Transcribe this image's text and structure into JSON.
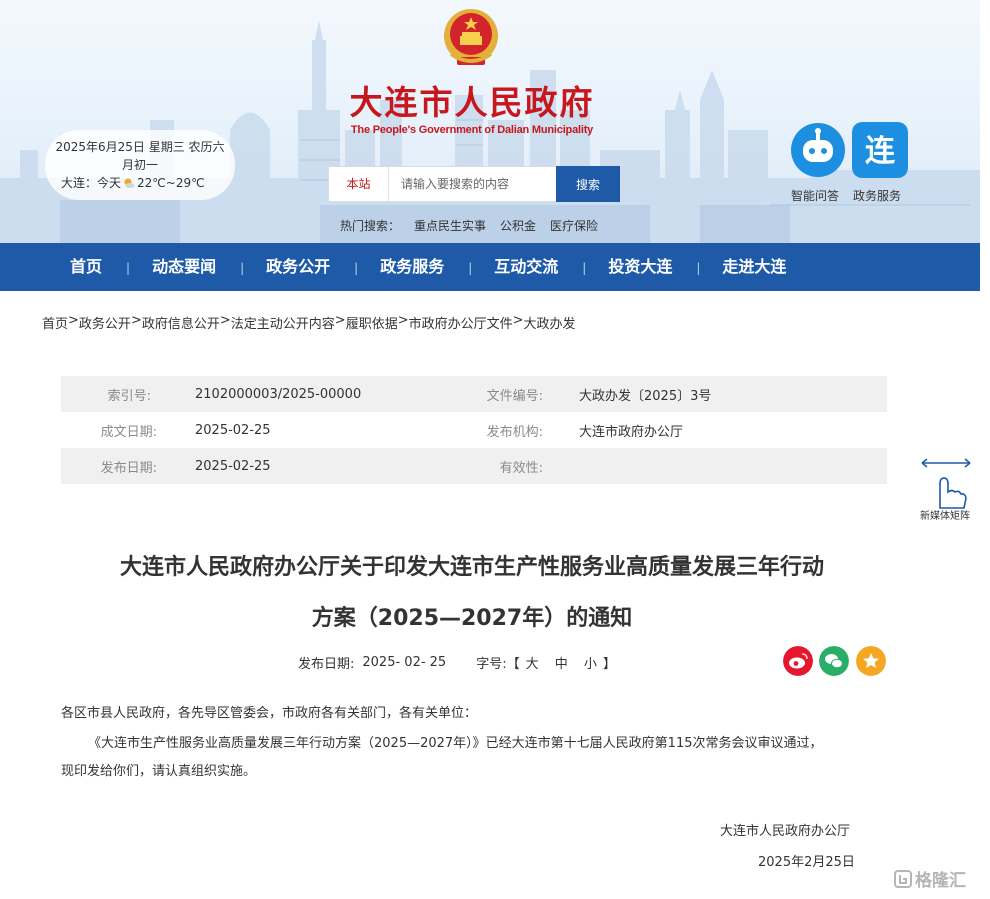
{
  "header": {
    "title": "大连市人民政府",
    "subtitle": "The People's Government of Dalian Municipality",
    "date_line1": "2025年6月25日 星期三 农历六",
    "date_line2": "月初一",
    "weather_prefix": "大连：今天",
    "weather_temp": "22℃~29℃",
    "search": {
      "scope": "本站",
      "placeholder": "请输入要搜索的内容",
      "button": "搜索"
    },
    "hot_search": {
      "label": "热门搜索：",
      "items": [
        "重点民生实事",
        "公积金",
        "医疗保险"
      ]
    },
    "quick_links": {
      "qa": "智能问答",
      "service": "政务服务",
      "service_glyph": "连"
    }
  },
  "nav": [
    "首页",
    "动态要闻",
    "政务公开",
    "政务服务",
    "互动交流",
    "投资大连",
    "走进大连"
  ],
  "breadcrumb": [
    "首页",
    "政务公开",
    "政府信息公开",
    "法定主动公开内容",
    "履职依据",
    "市政府办公厅文件",
    "大政办发"
  ],
  "meta": {
    "index_label": "索引号:",
    "index_value": "2102000003/2025-00000",
    "doc_no_label": "文件编号:",
    "doc_no_value": "大政办发〔2025〕3号",
    "written_label": "成文日期:",
    "written_value": "2025-02-25",
    "issuer_label": "发布机构:",
    "issuer_value": "大连市政府办公厅",
    "publish_label": "发布日期:",
    "publish_value": "2025-02-25",
    "validity_label": "有效性:",
    "validity_value": ""
  },
  "side": {
    "media_label": "新媒体矩阵"
  },
  "article": {
    "title_line1": "大连市人民政府办公厅关于印发大连市生产性服务业高质量发展三年行动",
    "title_line2": "方案（2025—2027年）的通知",
    "pub_label": "发布日期:",
    "pub_value": "2025- 02- 25",
    "font_label": "字号:【",
    "font_large": "大",
    "font_medium": "中",
    "font_small": "小",
    "font_close": "】",
    "salutation": "各区市县人民政府，各先导区管委会，市政府各有关部门，各有关单位：",
    "para1_line1": "《大连市生产性服务业高质量发展三年行动方案（2025—2027年）》已经大连市第十七届人民政府第115次常务会议审议通过，",
    "para1_line2": "现印发给你们，请认真组织实施。",
    "sign_org": "大连市人民政府办公厅",
    "sign_date": "2025年2月25日"
  },
  "watermark": "格隆汇",
  "colors": {
    "brand_red": "#c8161d",
    "nav_blue": "#1e5aa8",
    "weibo": "#e6162d",
    "wechat": "#2aae67",
    "favorite": "#f5a623"
  }
}
